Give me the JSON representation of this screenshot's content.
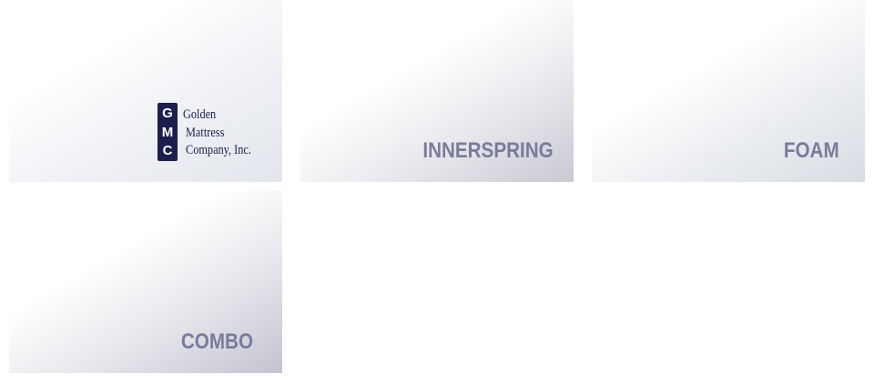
{
  "logo": {
    "letters": [
      "G",
      "M",
      "C"
    ],
    "lines": [
      "Golden",
      "Mattress",
      "Company, Inc."
    ]
  },
  "tiles": {
    "innerspring": "INNERSPRING",
    "foam": "FOAM",
    "combo": "COMBO"
  },
  "colors": {
    "logo_navy": "#1c1f4d",
    "label": "#7a7b9c"
  }
}
